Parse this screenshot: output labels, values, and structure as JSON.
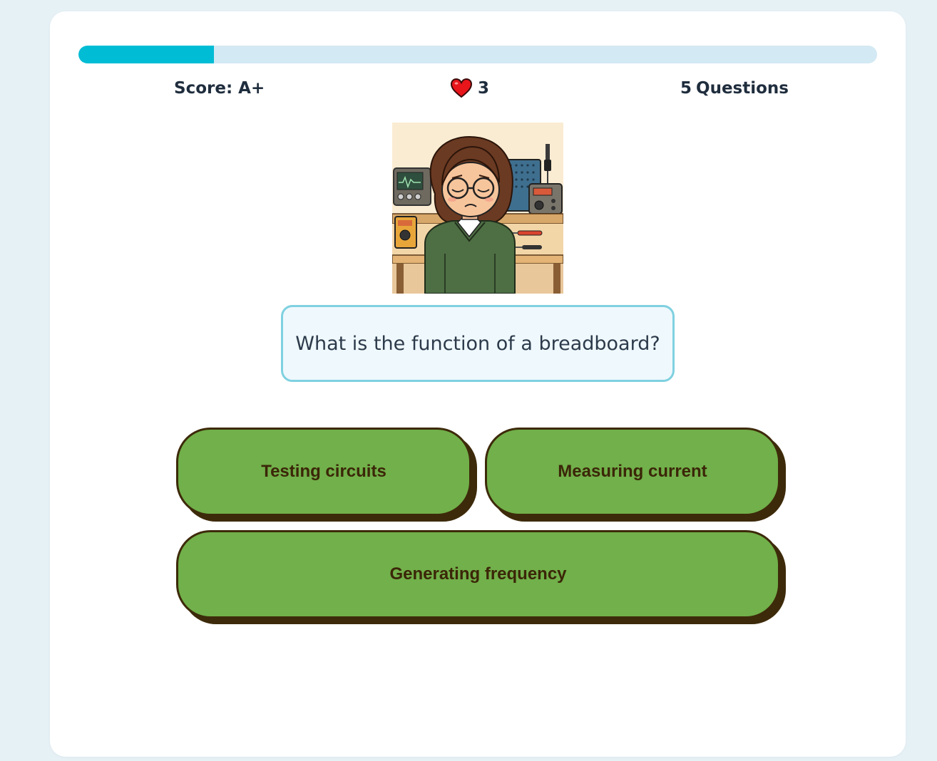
{
  "progress": {
    "fraction": 0.17
  },
  "stats": {
    "score_label": "Score:",
    "score_value": "A+",
    "lives": "3",
    "question_count": "5",
    "question_label": "Questions"
  },
  "icons": {
    "heart": "heart-icon",
    "portrait": "sad-student-in-electronics-lab"
  },
  "question": {
    "text": "What is the function of a breadboard?"
  },
  "answers": [
    {
      "label": "Testing circuits"
    },
    {
      "label": "Measuring current"
    },
    {
      "label": "Generating frequency"
    }
  ],
  "colors": {
    "accent": "#00bcd4",
    "track": "#d3e9f3",
    "answer_bg": "#71b04a",
    "answer_border": "#3d2a0a",
    "heart": "#e8151b"
  }
}
